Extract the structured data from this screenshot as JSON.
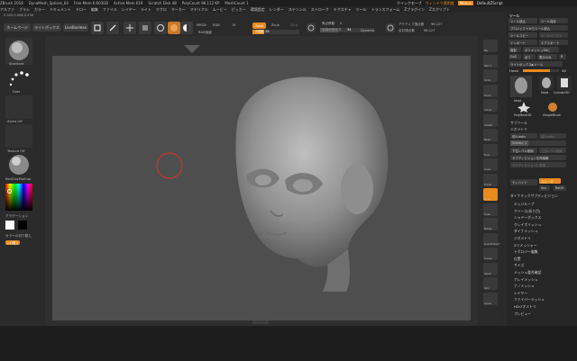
{
  "titlebar": {
    "items": [
      "ZBrush 2018",
      "DynaMesh_Sphere_64",
      "Free Mem 6.603GB",
      "Active Mem 619",
      "Scratch Disk 48",
      "PolyCount 98.112 KP",
      "MeshCount 1"
    ],
    "quick_save": "クイックセーブ",
    "window_transparency": "ウィンドウ透明度",
    "menus_label": "Menus",
    "script_label": "DefaultZScript"
  },
  "menubar": [
    "アルファ",
    "ブラシ",
    "カラー",
    "ドキュメント",
    "ドロー",
    "編集",
    "ファイル",
    "レイヤー",
    "ライト",
    "マクロ",
    "マーカー",
    "マテリアル",
    "ムービー",
    "ピッカー",
    "環境設定",
    "レンダー",
    "ステンシル",
    "ストローク",
    "テクスチャ",
    "ツール",
    "トランスフォーム",
    "Zプラグイン",
    "Zスクリプト"
  ],
  "status_line": "0.305,0.008,0.434",
  "topbar": {
    "home": "ホームページ",
    "lightbox": "ライトボックス",
    "live_boolean": "LiveBoolean",
    "edit": "Edit",
    "draw": "Draw",
    "move": "Move",
    "scale": "Scale",
    "rotate": "Rotate",
    "mrgb": "MRGB",
    "rgb": "RGB",
    "m": "M",
    "zadd": "Zadd",
    "zsub": "Zsub",
    "zcut": "Zcut",
    "rgb_intensity": "RGB強度",
    "z_intensity_label": "Z強度",
    "z_intensity_value": "25",
    "focal_shift_label": "焦点移動",
    "focal_shift_value": "0",
    "draw_size_label": "ドローサイズ",
    "draw_size_value": "34",
    "dynamic": "Dynamic",
    "active_points_label": "アクティブ頂点数",
    "active_points_value": "98,127",
    "total_points_label": "合計頂点数",
    "total_points_value": "98,127"
  },
  "leftpanel": {
    "brush": "Standard",
    "stroke": "Dots",
    "alpha": "Alpha Off",
    "texture": "Texture Off",
    "material": "RedClayMatCap",
    "gradient": "グラデーション",
    "switch_color": "カラーの切り替え",
    "alternate": "入れ替え"
  },
  "rightdock": [
    "Bpr",
    "SPix 3",
    "Scroll",
    "Zoom",
    "Actual",
    "AAHalf",
    "Persp",
    "Floor",
    "Local",
    "Frame",
    "Move",
    "Scale",
    "Rotate",
    "Line Fill PolyF",
    "Transp",
    "Ghost",
    "Solo",
    "Xpose"
  ],
  "toolpanel": {
    "header": "ツール",
    "buttons": [
      "ツール読込",
      "ツール保存",
      "プロジェクトからツール読込",
      "ツールコピー",
      "ツールペースト",
      "インポート",
      "エクスポート",
      "複製",
      "ポリメッシュ3Dに",
      "GoZ",
      "全て",
      "表示のみ",
      "R",
      "ライトボックス▶ツール"
    ],
    "tool_name": "Head",
    "tool_value": "48",
    "thumbnails": [
      "Head",
      "Head",
      "Cylinder3D",
      "PolyMesh3D",
      "SimpleBrush"
    ],
    "subtool": "サブツール",
    "geometry": "ジオメトリ",
    "lower_res": "低Subdiv",
    "higher_res": "高Subdiv",
    "sdiv_label": "Subdiv",
    "sdiv_value": "1",
    "delete_lower": "下位レベル削除",
    "delete_higher": "上位レベル削除",
    "reconstruct": "サブディビジョンを再構築",
    "convert": "サブディビジョンに変換",
    "divide": "ディバイド",
    "smooth": "スムーズ",
    "suv": "Suv",
    "reuv": "ReUV",
    "dynamic_subdiv": "ダイナミックサブディビジョン",
    "menu": [
      "エッジループ",
      "クリース(折り目)",
      "シャドーボックス",
      "クレイポリッシュ",
      "ダイナメッシュ",
      "ジオメトリ",
      "Zリメッシャー",
      "トポロジー編集",
      "位置",
      "サイズ",
      "メッシュ整合確認",
      "アレイメッシュ",
      "ナノメッシュ",
      "レイヤー",
      "ファイバーメッシュ",
      "HDジオメトリ",
      "プレビュー"
    ]
  }
}
